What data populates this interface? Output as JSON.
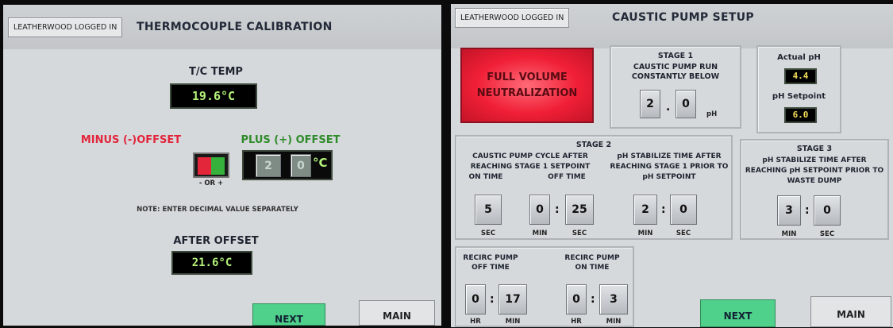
{
  "left_screen": {
    "login_label": "LEATHERWOOD LOGGED IN",
    "title": "THERMOCOUPLE CALIBRATION",
    "tc_temp": {
      "label": "T/C TEMP",
      "value": "19.6°C"
    },
    "minus_offset_label": "MINUS (-)OFFSET",
    "plus_offset_label": "PLUS (+) OFFSET",
    "toggle_caption": "- OR +",
    "offset_entry": {
      "whole": "2",
      "decimal": "0",
      "unit": "°C"
    },
    "note": "NOTE: ENTER DECIMAL VALUE SEPARATELY",
    "after_offset": {
      "label": "AFTER OFFSET",
      "value": "21.6°C"
    },
    "next_label": "NEXT",
    "main_label": "MAIN"
  },
  "right_screen": {
    "login_label": "LEATHERWOOD LOGGED IN",
    "title": "CAUSTIC PUMP SETUP",
    "full_volume_button": "FULL VOLUME NEUTRALIZATION",
    "stage1": {
      "title": "STAGE 1",
      "desc": "CAUSTIC PUMP RUN CONSTANTLY BELOW",
      "whole": "2",
      "decimal": "0",
      "unit": "pH"
    },
    "actual_ph": {
      "label": "Actual pH",
      "value": "4.4"
    },
    "ph_setpoint": {
      "label": "pH Setpoint",
      "value": "6.0"
    },
    "stage2": {
      "title": "STAGE 2",
      "cycle_desc": "CAUSTIC PUMP CYCLE AFTER REACHING STAGE 1 SETPOINT",
      "on_time_label": "ON TIME",
      "off_time_label": "OFF TIME",
      "on_sec": "5",
      "off_min": "0",
      "off_sec": "25",
      "stabilize_desc": "pH STABILIZE TIME AFTER REACHING STAGE 1 PRIOR TO pH SETPOINT",
      "stab_min": "2",
      "stab_sec": "0"
    },
    "stage3": {
      "title": "STAGE 3",
      "desc": "pH STABILIZE TIME AFTER REACHING pH SETPOINT PRIOR TO WASTE DUMP",
      "min": "3",
      "sec": "0"
    },
    "recirc_off": {
      "label": "RECIRC PUMP OFF TIME",
      "hr": "0",
      "min": "17"
    },
    "recirc_on": {
      "label": "RECIRC PUMP ON TIME",
      "hr": "0",
      "min": "3"
    },
    "units": {
      "sec": "SEC",
      "min": "MIN",
      "hr": "HR"
    },
    "next_label": "NEXT",
    "main_label": "MAIN"
  },
  "colors": {
    "red_label": "#e2263b",
    "green_label": "#2f8b2a",
    "next_green": "#4fd08b",
    "alarm_red": "#f4243c",
    "display_green": "#b3f27a",
    "display_yellow": "#f2dc5a"
  }
}
